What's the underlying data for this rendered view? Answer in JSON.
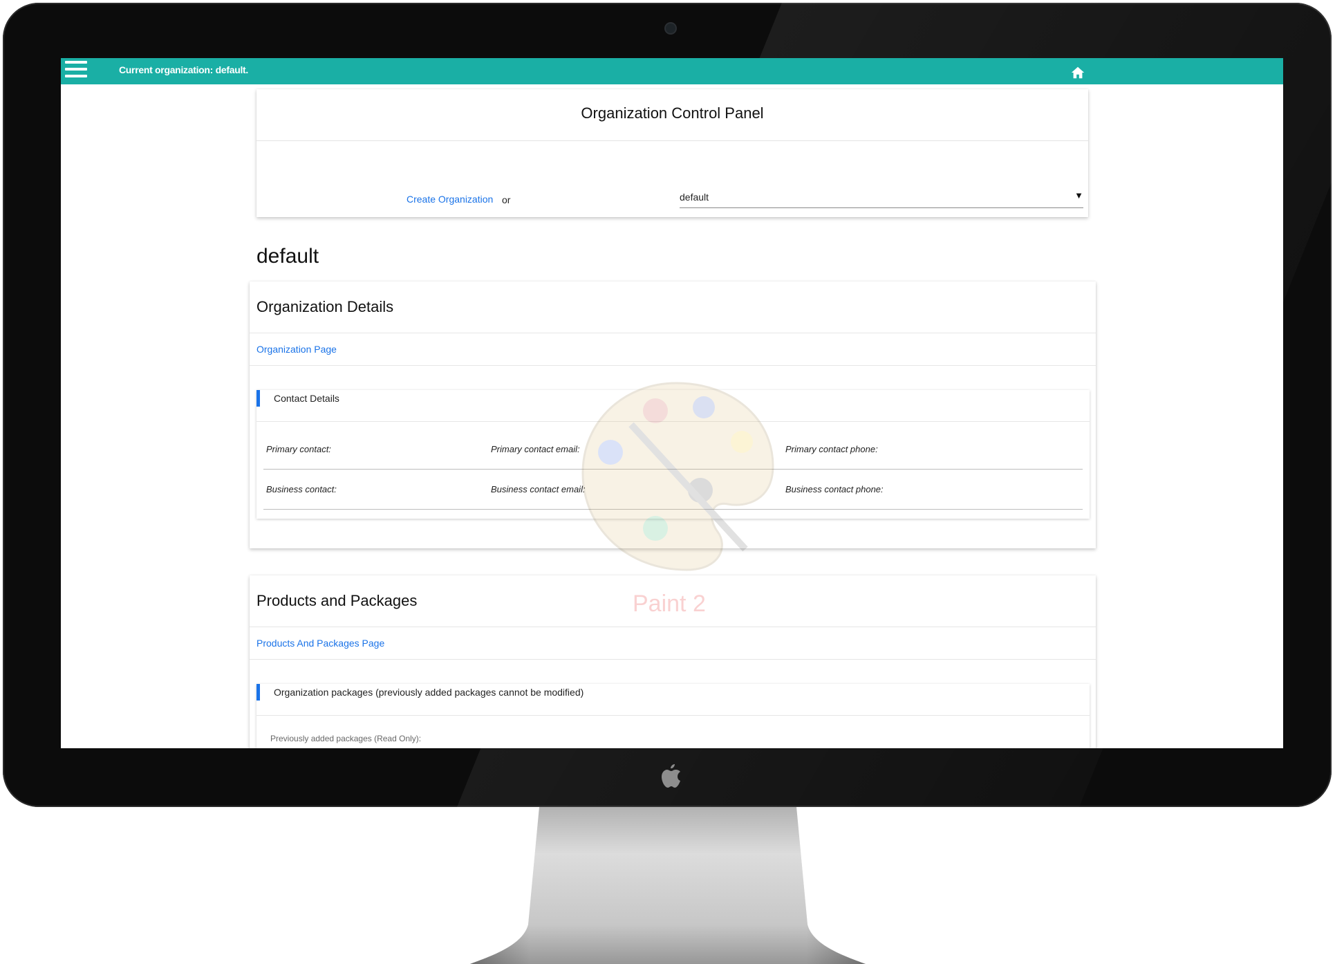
{
  "topbar": {
    "current_org_text": "Current organization: default.",
    "menu_icon": "hamburger-menu-icon",
    "home_icon": "home-icon",
    "color": "#1aafa5"
  },
  "control_panel": {
    "title": "Organization Control Panel",
    "create_link": "Create Organization",
    "or_text": "or",
    "select_value": "default",
    "select_arrow": "▼"
  },
  "org_heading": "default",
  "organization_details": {
    "title": "Organization Details",
    "page_link": "Organization Page",
    "contact_details": {
      "title": "Contact Details",
      "primary_contact": "Primary contact:",
      "primary_contact_email": "Primary contact email:",
      "primary_contact_phone": "Primary contact phone:",
      "business_contact": "Business contact:",
      "business_contact_email": "Business contact email:",
      "business_contact_phone": "Business contact phone:"
    }
  },
  "products_and_packages": {
    "title": "Products and Packages",
    "page_link": "Products And Packages Page",
    "packages_card": {
      "title": "Organization packages (previously added packages cannot be modified)",
      "readonly_label": "Previously added packages (Read Only):"
    }
  },
  "watermark": {
    "text": "Paint 2",
    "icon": "paint-palette-icon"
  },
  "device": {
    "logo_icon": "apple-logo-icon",
    "accent_color": "#1a73e8"
  }
}
